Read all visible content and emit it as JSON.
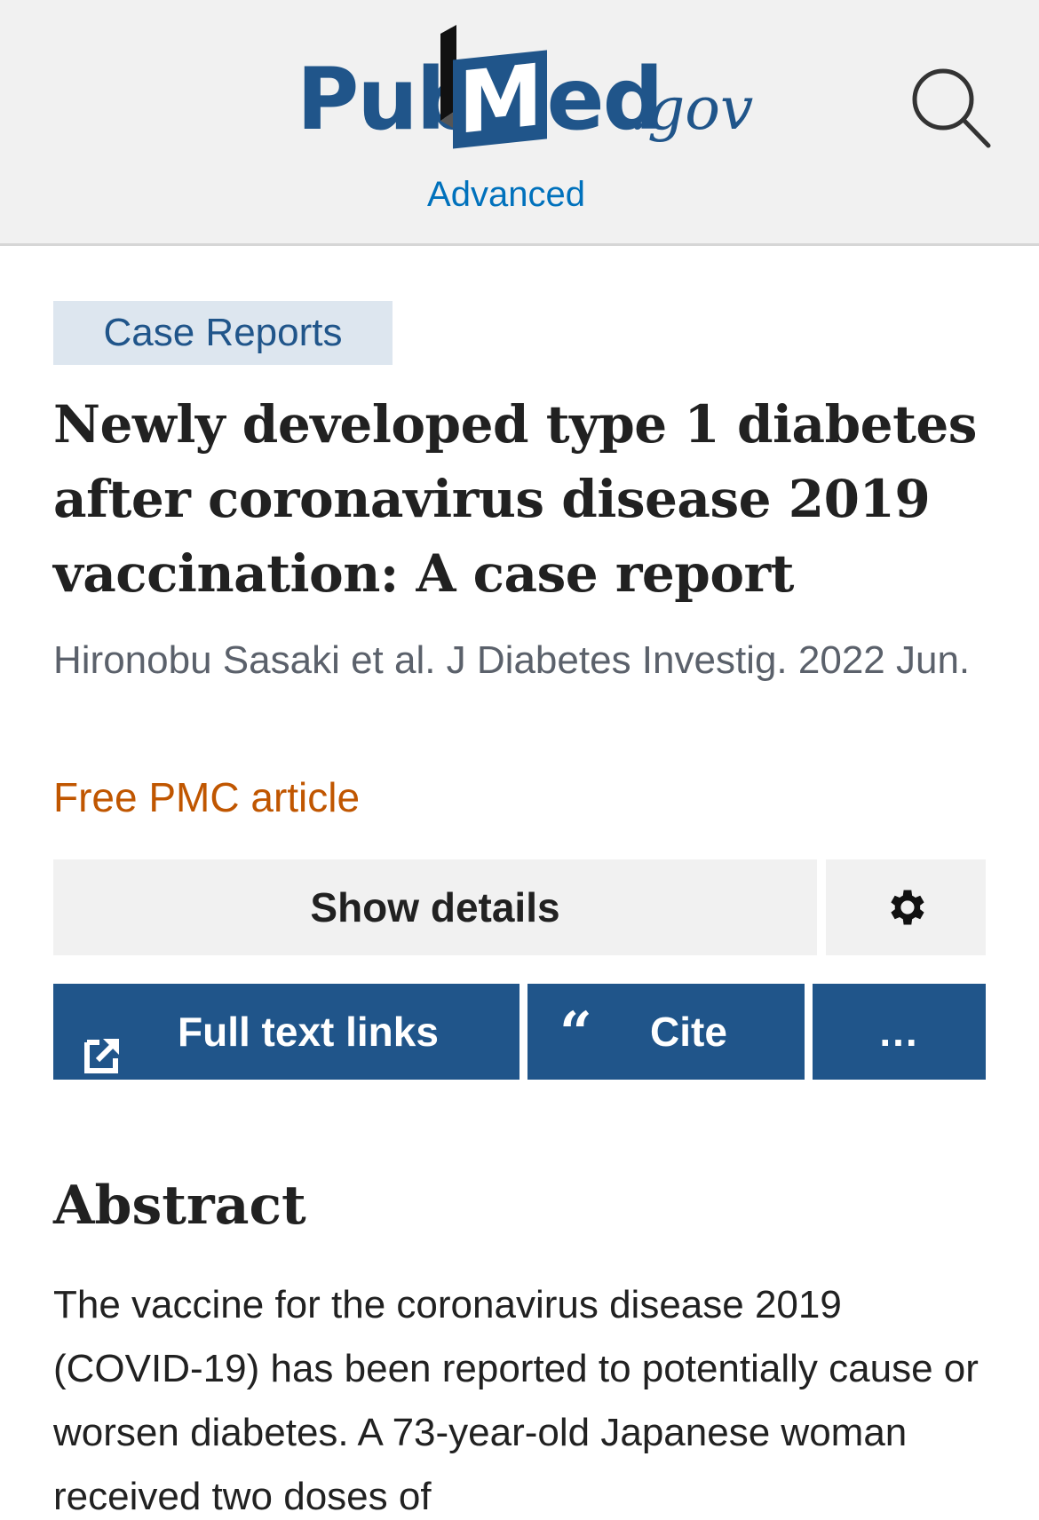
{
  "header": {
    "logo": {
      "pub": "Pub",
      "med": "Med",
      "gov": ".gov",
      "m_letter": "M",
      "ed": "ed"
    },
    "advanced_label": "Advanced",
    "search_icon": "search-icon"
  },
  "article": {
    "type_badge": "Case Reports",
    "title": "Newly developed type 1 diabetes after coronavirus disease 2019 vaccination: A case report",
    "citation": "Hironobu Sasaki et al. J Diabetes Investig. 2022 Jun.",
    "free_pmc": "Free PMC article"
  },
  "actions": {
    "show_details": "Show details",
    "settings_icon": "gear-icon",
    "full_text_links": "Full text links",
    "full_text_icon": "external-link-icon",
    "cite": "Cite",
    "cite_icon": "quote-icon",
    "cite_quote": "“",
    "more": "..."
  },
  "abstract": {
    "heading": "Abstract",
    "text": "The vaccine for the coronavirus disease 2019 (COVID-19) has been reported to potentially cause or worsen diabetes. A 73-year-old Japanese woman received two doses of"
  },
  "colors": {
    "brand_blue": "#20558a",
    "link_blue": "#0071bc",
    "orange": "#c05600",
    "header_bg": "#f1f1f1",
    "badge_bg": "#dde6ef"
  }
}
